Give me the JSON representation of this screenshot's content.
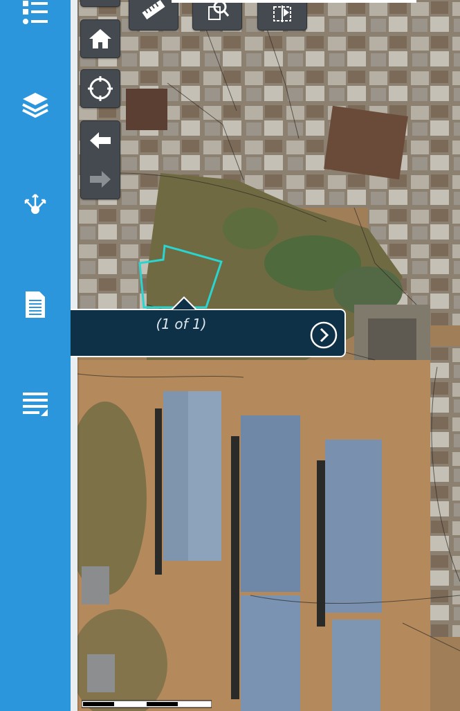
{
  "sidebar": {
    "items": [
      {
        "icon": "list-icon"
      },
      {
        "icon": "layers-icon"
      },
      {
        "icon": "share-network-icon"
      },
      {
        "icon": "document-icon"
      },
      {
        "icon": "edit-list-icon"
      }
    ]
  },
  "map_tools": {
    "home": "home-icon",
    "locate": "locate-icon",
    "back": "arrow-left-icon",
    "forward": "arrow-right-icon",
    "measure": "ruler-icon",
    "search": "document-search-icon",
    "compare": "compare-icon"
  },
  "popup": {
    "count_text": "(1 of 1)"
  },
  "colors": {
    "sidebar": "#2b96dc",
    "popup_bg": "#0f3148",
    "parcel_highlight": "#2ad5d0",
    "tool_bg": "#444a50"
  }
}
